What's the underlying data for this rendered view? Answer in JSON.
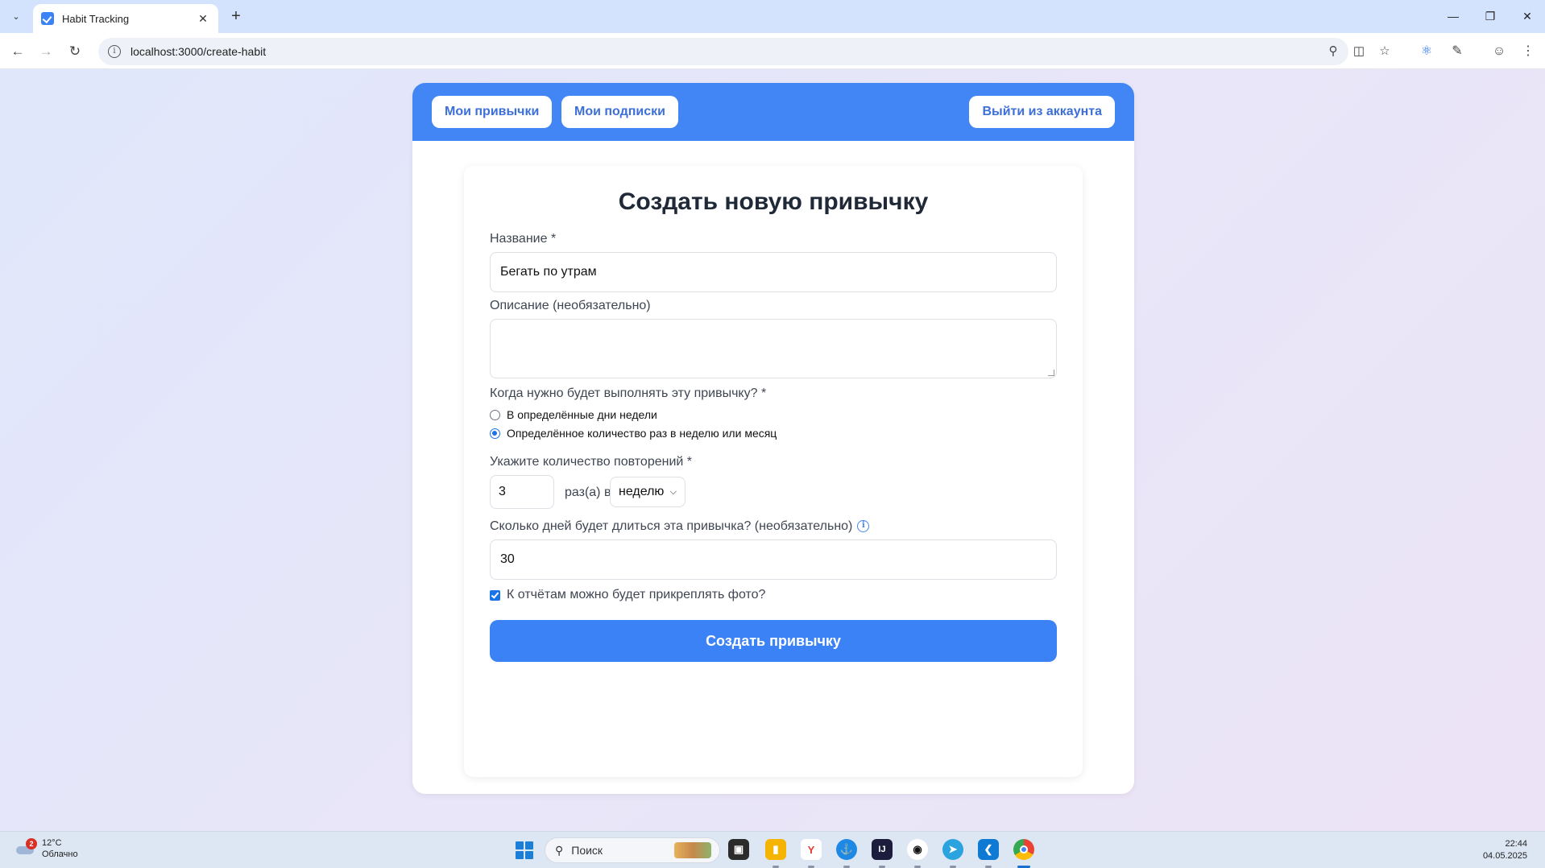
{
  "browser": {
    "tab_title": "Habit Tracking",
    "url": "localhost:3000/create-habit"
  },
  "header": {
    "my_habits": "Мои привычки",
    "my_subscriptions": "Мои подписки",
    "logout": "Выйти из аккаунта"
  },
  "form": {
    "title": "Создать новую привычку",
    "name_label": "Название *",
    "name_value": "Бегать по утрам",
    "description_label": "Описание (необязательно)",
    "description_value": "",
    "schedule_label": "Когда нужно будет выполнять эту привычку? *",
    "schedule_options": [
      {
        "label": "В определённые дни недели",
        "checked": false
      },
      {
        "label": "Определённое количество раз в неделю или месяц",
        "checked": true
      }
    ],
    "repeat_label": "Укажите количество повторений *",
    "repeat_count": "3",
    "repeat_per_text": "раз(а) в",
    "repeat_period": "неделю",
    "duration_label": "Сколько дней будет длиться эта привычка? (необязательно)",
    "duration_value": "30",
    "photo_label": "К отчётам можно будет прикреплять фото?",
    "photo_checked": true,
    "submit": "Создать привычку"
  },
  "taskbar": {
    "weather_temp": "12°C",
    "weather_desc": "Облачно",
    "weather_badge": "2",
    "search_placeholder": "Поиск",
    "time": "22:44",
    "date": "04.05.2025"
  }
}
